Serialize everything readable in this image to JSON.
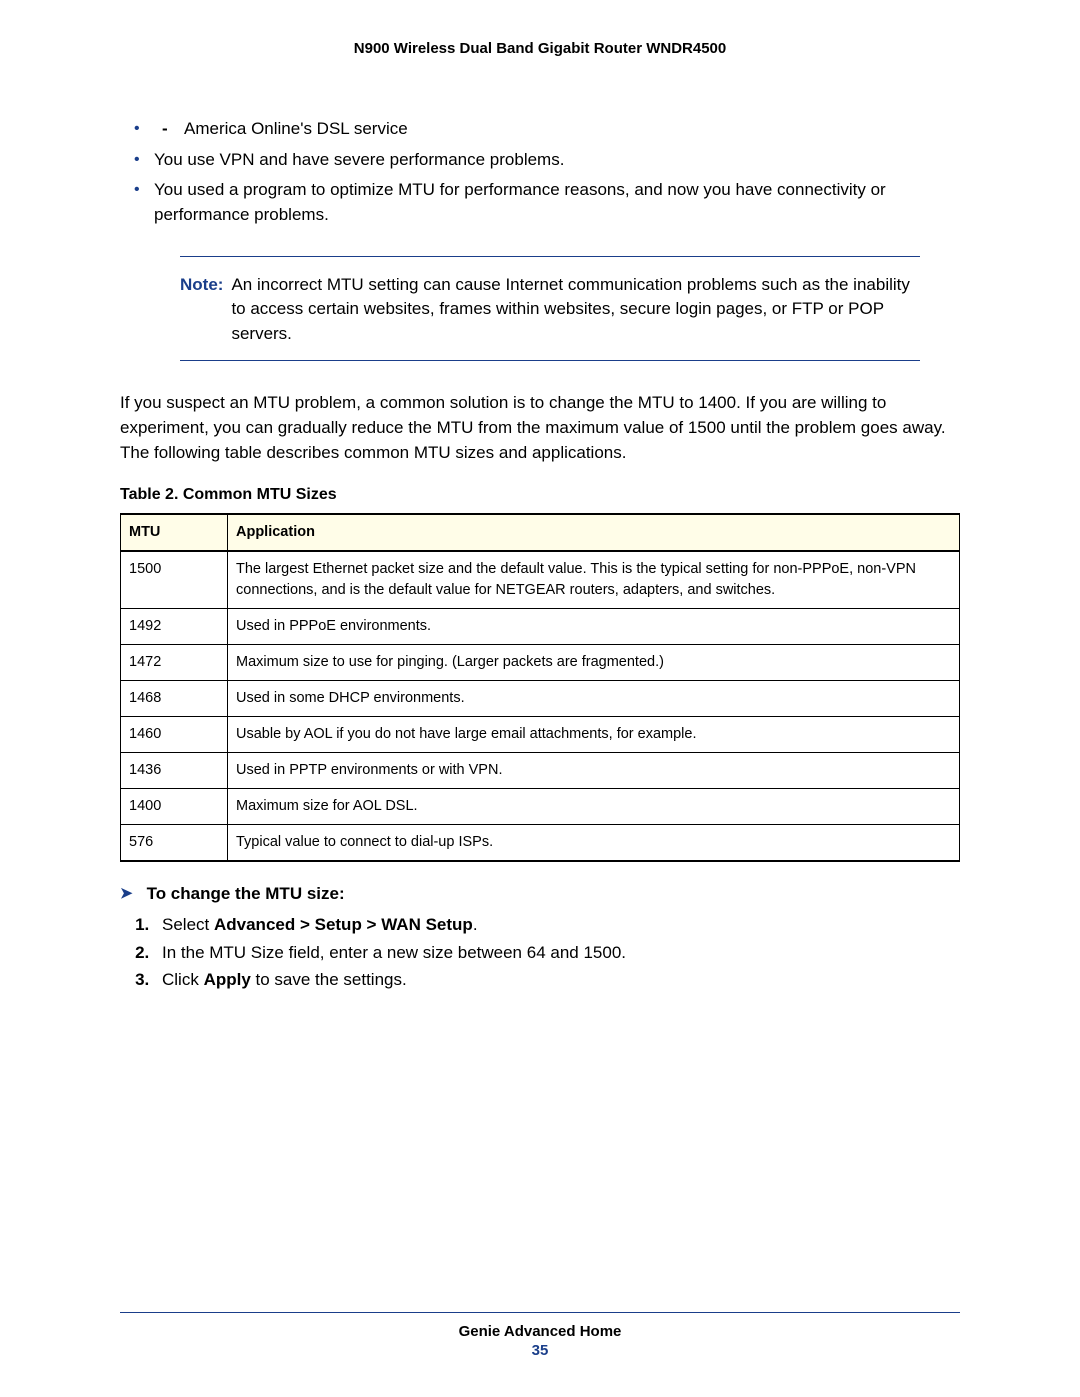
{
  "header": {
    "title": "N900 Wireless Dual Band Gigabit Router WNDR4500"
  },
  "top_list": {
    "sub_item": "America Online's DSL service",
    "item2": "You use VPN and have severe performance problems.",
    "item3": "You used a program to optimize MTU for performance reasons, and now you have connectivity or performance problems."
  },
  "note": {
    "label": "Note:",
    "text": "An incorrect MTU setting can cause Internet communication problems such as the inability to access certain websites, frames within websites, secure login pages, or FTP or POP servers."
  },
  "paragraph": "If you suspect an MTU problem, a common solution is to change the MTU to 1400. If you are willing to experiment, you can gradually reduce the MTU from the maximum value of 1500 until the problem goes away. The following table describes common MTU sizes and applications.",
  "table": {
    "caption": "Table 2.  Common MTU Sizes",
    "head_mtu": "MTU",
    "head_app": "Application",
    "rows": [
      {
        "mtu": "1500",
        "app": "The largest Ethernet packet size and the default value. This is the typical setting for non-PPPoE, non-VPN connections, and is the default value for NETGEAR routers, adapters, and switches."
      },
      {
        "mtu": "1492",
        "app": "Used in PPPoE environments."
      },
      {
        "mtu": "1472",
        "app": "Maximum size to use for pinging. (Larger packets are fragmented.)"
      },
      {
        "mtu": "1468",
        "app": "Used in some DHCP environments."
      },
      {
        "mtu": "1460",
        "app": "Usable by AOL if you do not have large email attachments, for example."
      },
      {
        "mtu": "1436",
        "app": "Used in PPTP environments or with VPN."
      },
      {
        "mtu": "1400",
        "app": "Maximum size for AOL DSL."
      },
      {
        "mtu": "576",
        "app": "Typical value to connect to dial-up ISPs."
      }
    ]
  },
  "procedure": {
    "heading": "To change the MTU size:",
    "step1_pre": "Select ",
    "step1_bold": "Advanced > Setup > WAN Setup",
    "step1_post": ".",
    "step2": "In the MTU Size field, enter a new size between 64 and 1500.",
    "step3_pre": "Click ",
    "step3_bold": "Apply",
    "step3_post": " to save the settings."
  },
  "footer": {
    "section": "Genie Advanced Home",
    "page": "35"
  }
}
